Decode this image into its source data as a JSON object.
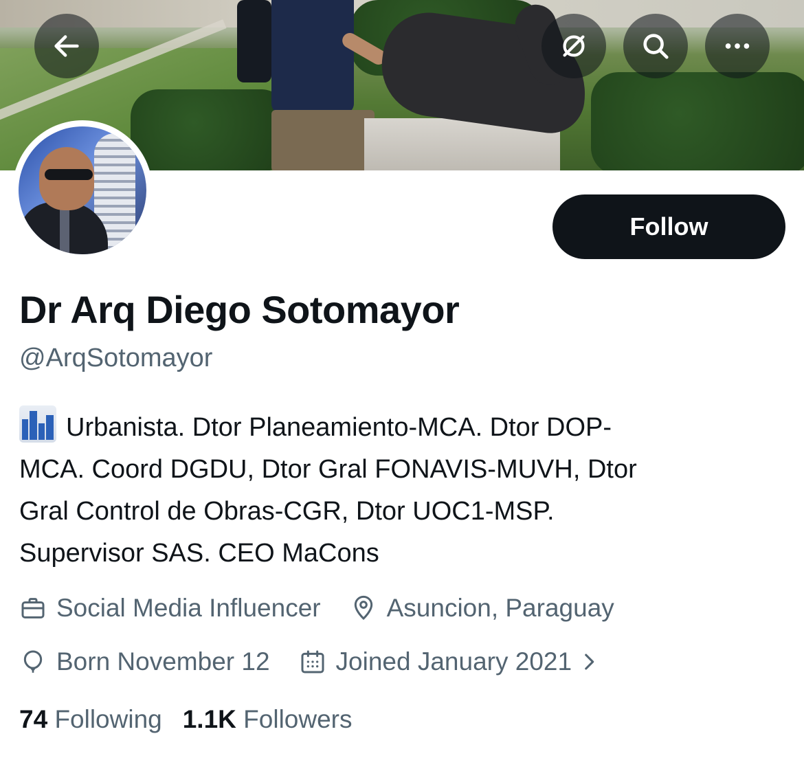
{
  "header": {
    "back_icon": "arrow-left-icon",
    "spaces_icon": "spaces-icon",
    "search_icon": "search-icon",
    "more_icon": "more-horizontal-icon"
  },
  "profile": {
    "name": "Dr Arq Diego Sotomayor",
    "handle": "@ArqSotomayor",
    "follow_label": "Follow",
    "bio_lines": [
      "Urbanista. Dtor Planeamiento-MCA. Dtor DOP-",
      "MCA. Coord DGDU, Dtor Gral FONAVIS-MUVH, Dtor",
      "Gral Control de Obras-CGR, Dtor UOC1-MSP.",
      "Supervisor SAS. CEO MaCons"
    ],
    "category": "Social Media Influencer",
    "location": "Asuncion, Paraguay",
    "birthday": "Born November 12",
    "joined": "Joined January 2021"
  },
  "stats": {
    "following_count": "74",
    "following_label": "Following",
    "followers_count": "1.1K",
    "followers_label": "Followers"
  },
  "colors": {
    "primary_text": "#0f1419",
    "secondary_text": "#536471",
    "button_bg": "#0f1419"
  }
}
